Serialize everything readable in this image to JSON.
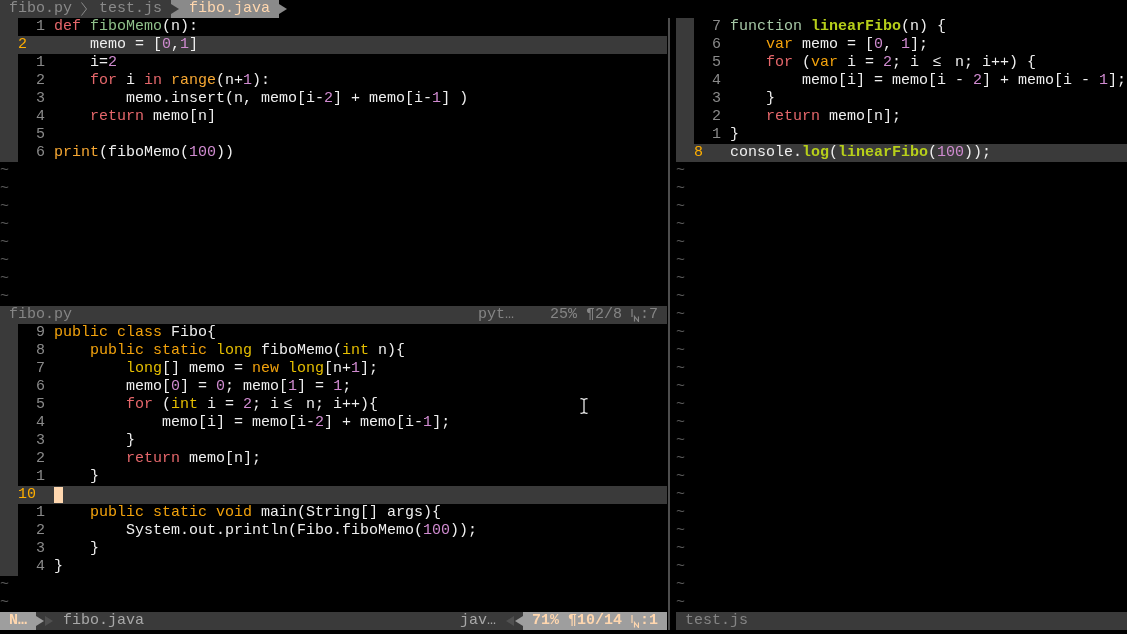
{
  "tabline": {
    "tabs": [
      {
        "label": "fibo.py",
        "selected": false
      },
      {
        "label": "test.js",
        "selected": false
      },
      {
        "label": "fibo.java",
        "selected": true
      }
    ]
  },
  "columns": [
    {
      "panes": [
        {
          "active": false,
          "lines": [
            {
              "number": "1",
              "current": false,
              "tokens": [
                {
                  "text": "def ",
                  "kind": "keyword"
                },
                {
                  "text": "fiboMemo",
                  "kind": "function"
                },
                {
                  "text": "(n):",
                  "kind": "plain"
                }
              ]
            },
            {
              "number": "2",
              "current": true,
              "tokens": [
                {
                  "text": "    memo = [",
                  "kind": "plain"
                },
                {
                  "text": "0",
                  "kind": "number"
                },
                {
                  "text": ",",
                  "kind": "plain"
                },
                {
                  "text": "1",
                  "kind": "number"
                },
                {
                  "text": "]",
                  "kind": "plain"
                }
              ]
            },
            {
              "number": "1",
              "current": false,
              "tokens": [
                {
                  "text": "    i=",
                  "kind": "plain"
                },
                {
                  "text": "2",
                  "kind": "number"
                }
              ]
            },
            {
              "number": "2",
              "current": false,
              "tokens": [
                {
                  "text": "    for",
                  "kind": "keyword"
                },
                {
                  "text": " i ",
                  "kind": "plain"
                },
                {
                  "text": "in ",
                  "kind": "keyword"
                },
                {
                  "text": "range",
                  "kind": "builtin"
                },
                {
                  "text": "(n+",
                  "kind": "plain"
                },
                {
                  "text": "1",
                  "kind": "number"
                },
                {
                  "text": "):",
                  "kind": "plain"
                }
              ]
            },
            {
              "number": "3",
              "current": false,
              "tokens": [
                {
                  "text": "        memo.insert(n, memo[i-",
                  "kind": "plain"
                },
                {
                  "text": "2",
                  "kind": "number"
                },
                {
                  "text": "] + memo[i-",
                  "kind": "plain"
                },
                {
                  "text": "1",
                  "kind": "number"
                },
                {
                  "text": "] )",
                  "kind": "plain"
                }
              ]
            },
            {
              "number": "4",
              "current": false,
              "tokens": [
                {
                  "text": "    return",
                  "kind": "keyword"
                },
                {
                  "text": " memo[n]",
                  "kind": "plain"
                }
              ]
            },
            {
              "number": "5",
              "current": false
            },
            {
              "number": "6",
              "current": false,
              "tokens": [
                {
                  "text": "print",
                  "kind": "builtin"
                },
                {
                  "text": "(fiboMemo(",
                  "kind": "plain"
                },
                {
                  "text": "100",
                  "kind": "number"
                },
                {
                  "text": "))",
                  "kind": "plain"
                }
              ]
            }
          ],
          "filler": [
            "~",
            "~",
            "~",
            "~",
            "~",
            "~",
            "~",
            "~"
          ],
          "status": {
            "filename": "fibo.py",
            "filetype": "pyt…",
            "position": "25% ¶2/8",
            "column": ":7"
          }
        },
        {
          "active": true,
          "lines": [
            {
              "number": "9",
              "current": false,
              "tokens": [
                {
                  "text": "public class",
                  "kind": "storage"
                },
                {
                  "text": " Fibo{",
                  "kind": "plain"
                }
              ]
            },
            {
              "number": "8",
              "current": false,
              "tokens": [
                {
                  "text": "    public static ",
                  "kind": "storage"
                },
                {
                  "text": "long",
                  "kind": "type"
                },
                {
                  "text": " fiboMemo(",
                  "kind": "plain"
                },
                {
                  "text": "int",
                  "kind": "type"
                },
                {
                  "text": " n){",
                  "kind": "plain"
                }
              ]
            },
            {
              "number": "7",
              "current": false,
              "tokens": [
                {
                  "text": "        long",
                  "kind": "type"
                },
                {
                  "text": "[] memo = ",
                  "kind": "plain"
                },
                {
                  "text": "new ",
                  "kind": "storage"
                },
                {
                  "text": "long",
                  "kind": "type"
                },
                {
                  "text": "[n+",
                  "kind": "plain"
                },
                {
                  "text": "1",
                  "kind": "number"
                },
                {
                  "text": "];",
                  "kind": "plain"
                }
              ]
            },
            {
              "number": "6",
              "current": false,
              "tokens": [
                {
                  "text": "        memo[",
                  "kind": "plain"
                },
                {
                  "text": "0",
                  "kind": "number"
                },
                {
                  "text": "] = ",
                  "kind": "plain"
                },
                {
                  "text": "0",
                  "kind": "number"
                },
                {
                  "text": "; memo[",
                  "kind": "plain"
                },
                {
                  "text": "1",
                  "kind": "number"
                },
                {
                  "text": "] = ",
                  "kind": "plain"
                },
                {
                  "text": "1",
                  "kind": "number"
                },
                {
                  "text": ";",
                  "kind": "plain"
                }
              ]
            },
            {
              "number": "5",
              "current": false,
              "tokens": [
                {
                  "text": "        for",
                  "kind": "keyword"
                },
                {
                  "text": " (",
                  "kind": "plain"
                },
                {
                  "text": "int",
                  "kind": "type"
                },
                {
                  "text": " i = ",
                  "kind": "plain"
                },
                {
                  "text": "2",
                  "kind": "number"
                },
                {
                  "text": "; i",
                  "kind": "plain"
                },
                {
                  "text": "≤",
                  "kind": "ligature"
                },
                {
                  "text": " n; i++){",
                  "kind": "plain"
                }
              ]
            },
            {
              "number": "4",
              "current": false,
              "tokens": [
                {
                  "text": "            memo[i] = memo[i-",
                  "kind": "plain"
                },
                {
                  "text": "2",
                  "kind": "number"
                },
                {
                  "text": "] + memo[i-",
                  "kind": "plain"
                },
                {
                  "text": "1",
                  "kind": "number"
                },
                {
                  "text": "];",
                  "kind": "plain"
                }
              ]
            },
            {
              "number": "3",
              "current": false,
              "tokens": [
                {
                  "text": "        }",
                  "kind": "plain"
                }
              ]
            },
            {
              "number": "2",
              "current": false,
              "tokens": [
                {
                  "text": "        return",
                  "kind": "keyword"
                },
                {
                  "text": " memo[n];",
                  "kind": "plain"
                }
              ]
            },
            {
              "number": "1",
              "current": false,
              "tokens": [
                {
                  "text": "    }",
                  "kind": "plain"
                }
              ]
            },
            {
              "number": "10",
              "current": true
            },
            {
              "number": "1",
              "current": false,
              "tokens": [
                {
                  "text": "    public static void",
                  "kind": "storage"
                },
                {
                  "text": " main(String[] args){",
                  "kind": "plain"
                }
              ]
            },
            {
              "number": "2",
              "current": false,
              "tokens": [
                {
                  "text": "        System.out.println(Fibo.fiboMemo(",
                  "kind": "plain"
                },
                {
                  "text": "100",
                  "kind": "number"
                },
                {
                  "text": "));",
                  "kind": "plain"
                }
              ]
            },
            {
              "number": "3",
              "current": false,
              "tokens": [
                {
                  "text": "    }",
                  "kind": "plain"
                }
              ]
            },
            {
              "number": "4",
              "current": false,
              "tokens": [
                {
                  "text": "}",
                  "kind": "plain"
                }
              ]
            }
          ],
          "filler": [
            "~",
            "~"
          ],
          "status": {
            "mode": "N…",
            "filename": "fibo.java",
            "filetype": "jav…",
            "position": "71% ¶10/14",
            "column": ":1"
          }
        }
      ]
    },
    {
      "panes": [
        {
          "active": false,
          "lines": [
            {
              "number": "7",
              "current": false,
              "tokens": [
                {
                  "text": "function ",
                  "kind": "declaration"
                },
                {
                  "text": "linearFibo",
                  "kind": "call"
                },
                {
                  "text": "(n) {",
                  "kind": "plain"
                }
              ]
            },
            {
              "number": "6",
              "current": false,
              "tokens": [
                {
                  "text": "    var",
                  "kind": "storage"
                },
                {
                  "text": " memo = [",
                  "kind": "plain"
                },
                {
                  "text": "0",
                  "kind": "number"
                },
                {
                  "text": ", ",
                  "kind": "plain"
                },
                {
                  "text": "1",
                  "kind": "number"
                },
                {
                  "text": "];",
                  "kind": "plain"
                }
              ]
            },
            {
              "number": "5",
              "current": false,
              "tokens": [
                {
                  "text": "    for",
                  "kind": "keyword"
                },
                {
                  "text": " (",
                  "kind": "plain"
                },
                {
                  "text": "var",
                  "kind": "storage"
                },
                {
                  "text": " i = ",
                  "kind": "plain"
                },
                {
                  "text": "2",
                  "kind": "number"
                },
                {
                  "text": "; i ",
                  "kind": "plain"
                },
                {
                  "text": "≤",
                  "kind": "ligature"
                },
                {
                  "text": " n; i++) {",
                  "kind": "plain"
                }
              ]
            },
            {
              "number": "4",
              "current": false,
              "tokens": [
                {
                  "text": "        memo[i] = memo[i - ",
                  "kind": "plain"
                },
                {
                  "text": "2",
                  "kind": "number"
                },
                {
                  "text": "] + memo[i - ",
                  "kind": "plain"
                },
                {
                  "text": "1",
                  "kind": "number"
                },
                {
                  "text": "];",
                  "kind": "plain"
                }
              ]
            },
            {
              "number": "3",
              "current": false,
              "tokens": [
                {
                  "text": "    }",
                  "kind": "plain"
                }
              ]
            },
            {
              "number": "2",
              "current": false,
              "tokens": [
                {
                  "text": "    return",
                  "kind": "keyword"
                },
                {
                  "text": " memo[n];",
                  "kind": "plain"
                }
              ]
            },
            {
              "number": "1",
              "current": false,
              "tokens": [
                {
                  "text": "}",
                  "kind": "plain"
                }
              ]
            },
            {
              "number": "8",
              "current": true,
              "tokens": [
                {
                  "text": "console.",
                  "kind": "plain"
                },
                {
                  "text": "log",
                  "kind": "call"
                },
                {
                  "text": "(",
                  "kind": "plain"
                },
                {
                  "text": "linearFibo",
                  "kind": "call"
                },
                {
                  "text": "(",
                  "kind": "plain"
                },
                {
                  "text": "100",
                  "kind": "number"
                },
                {
                  "text": "));",
                  "kind": "plain"
                }
              ]
            }
          ],
          "filler": [
            "~",
            "~",
            "~",
            "~",
            "~",
            "~",
            "~",
            "~",
            "~",
            "~",
            "~",
            "~",
            "~",
            "~",
            "~",
            "~",
            "~",
            "~",
            "~",
            "~",
            "~",
            "~",
            "~",
            "~",
            "~"
          ],
          "status": {
            "filename": "test.js"
          }
        }
      ]
    }
  ]
}
